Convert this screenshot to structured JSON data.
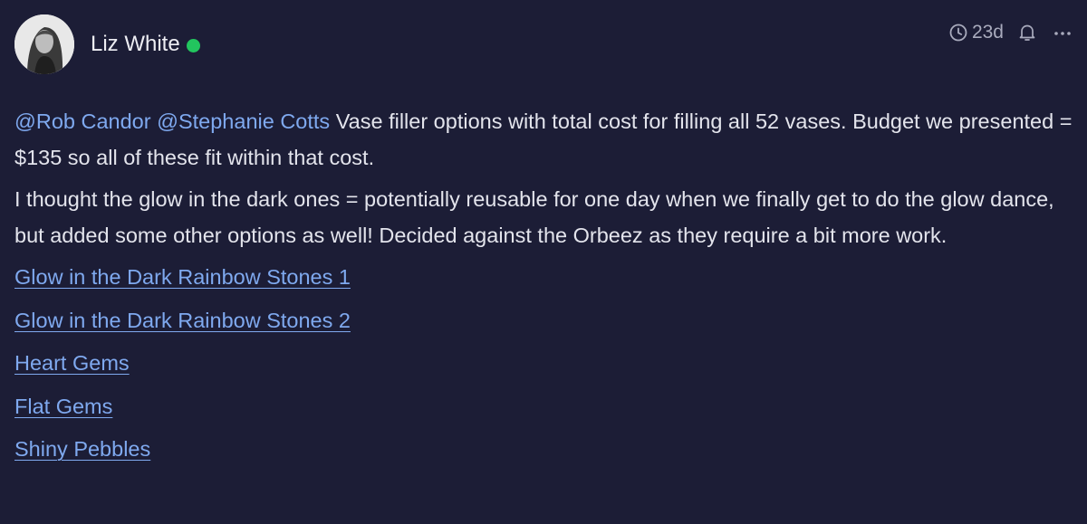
{
  "comment": {
    "author": {
      "name": "Liz White",
      "online": true,
      "status_color": "#22c55e",
      "avatar_icon": "person-avatar"
    },
    "meta": {
      "age": "23d",
      "clock_icon": "clock-icon",
      "bell_icon": "bell-icon",
      "more_icon": "more-dots-icon"
    },
    "mentions": [
      "@Rob Candor",
      "@Stephanie Cotts"
    ],
    "paragraph1_text": " Vase filler options with total cost for filling all 52 vases. Budget we presented = $135 so all of these fit within that cost.",
    "paragraph2": "I thought the glow in the dark ones = potentially reusable for one day when we finally get to do the glow dance, but added some other options as well! Decided against the Orbeez as they require a bit more work.",
    "links": [
      "Glow in the Dark Rainbow Stones 1",
      "Glow in the Dark Rainbow Stones 2",
      "Heart Gems",
      "Flat Gems",
      "Shiny Pebbles"
    ]
  },
  "colors": {
    "background": "#1c1d36",
    "text": "#e3e4ec",
    "link": "#7fa9ef",
    "muted": "#a9abbd",
    "online": "#22c55e"
  }
}
